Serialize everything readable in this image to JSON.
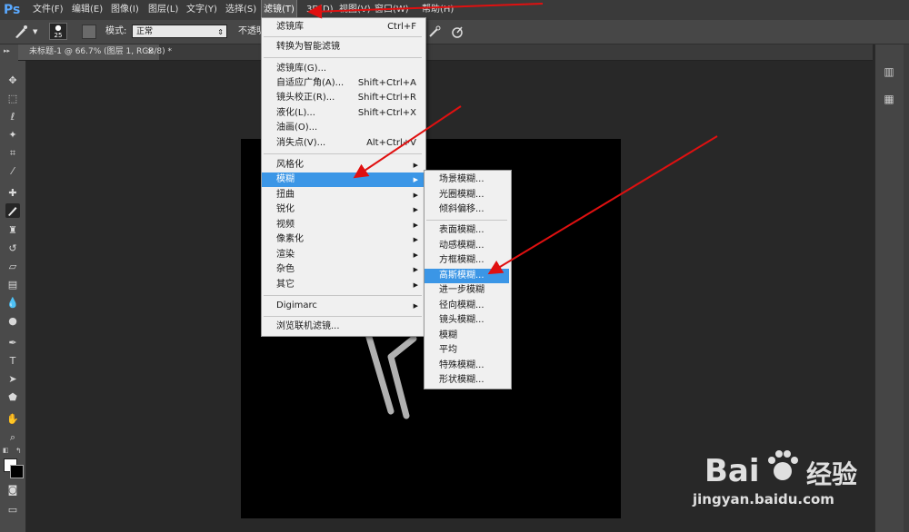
{
  "app": {
    "logo": "Ps"
  },
  "menubar": {
    "items": [
      "文件(F)",
      "编辑(E)",
      "图像(I)",
      "图层(L)",
      "文字(Y)",
      "选择(S)",
      "滤镜(T)",
      "3D(D)",
      "视图(V)",
      "窗口(W)",
      "帮助(H)"
    ],
    "active_index": 6
  },
  "options": {
    "brush_size": "25",
    "mode_label": "模式:",
    "mode_value": "正常",
    "opacity_label": "不透明"
  },
  "document": {
    "tab_title": "未标题-1 @ 66.7% (图层 1, RGB/8) *",
    "tab_close": "×"
  },
  "filter_menu": {
    "items": [
      {
        "label": "滤镜库",
        "shortcut": "Ctrl+F"
      },
      {
        "label": "转换为智能滤镜"
      },
      {
        "label": "滤镜库(G)..."
      },
      {
        "label": "自适应广角(A)...",
        "shortcut": "Shift+Ctrl+A"
      },
      {
        "label": "镜头校正(R)...",
        "shortcut": "Shift+Ctrl+R"
      },
      {
        "label": "液化(L)...",
        "shortcut": "Shift+Ctrl+X"
      },
      {
        "label": "油画(O)..."
      },
      {
        "label": "消失点(V)...",
        "shortcut": "Alt+Ctrl+V"
      },
      {
        "label": "风格化",
        "submenu": true
      },
      {
        "label": "模糊",
        "submenu": true,
        "highlighted": true
      },
      {
        "label": "扭曲",
        "submenu": true
      },
      {
        "label": "锐化",
        "submenu": true
      },
      {
        "label": "视频",
        "submenu": true
      },
      {
        "label": "像素化",
        "submenu": true
      },
      {
        "label": "渲染",
        "submenu": true
      },
      {
        "label": "杂色",
        "submenu": true
      },
      {
        "label": "其它",
        "submenu": true
      },
      {
        "label": "Digimarc",
        "submenu": true
      },
      {
        "label": "浏览联机滤镜..."
      }
    ]
  },
  "blur_menu": {
    "items": [
      {
        "label": "场景模糊..."
      },
      {
        "label": "光圈模糊..."
      },
      {
        "label": "倾斜偏移..."
      },
      {
        "label": "表面模糊..."
      },
      {
        "label": "动感模糊..."
      },
      {
        "label": "方框模糊..."
      },
      {
        "label": "高斯模糊...",
        "highlighted": true
      },
      {
        "label": "进一步模糊"
      },
      {
        "label": "径向模糊..."
      },
      {
        "label": "镜头模糊..."
      },
      {
        "label": "模糊"
      },
      {
        "label": "平均"
      },
      {
        "label": "特殊模糊..."
      },
      {
        "label": "形状模糊..."
      }
    ]
  },
  "watermark": {
    "brand_text": "Bai",
    "brand_cn": "经验",
    "url": "jingyan.baidu.com"
  },
  "colors": {
    "highlight": "#3b96e6",
    "arrow": "#e01010",
    "foreground": "#ffffff",
    "background": "#000000"
  }
}
